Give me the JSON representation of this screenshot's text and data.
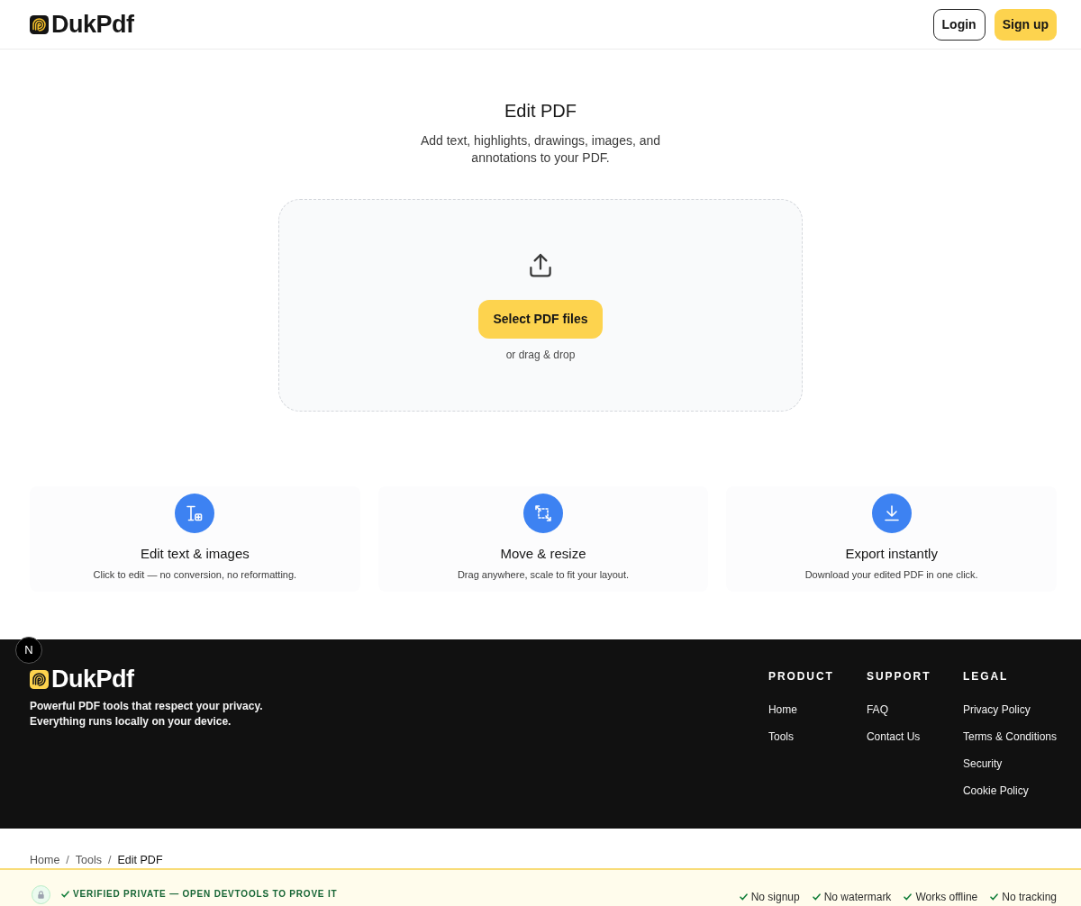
{
  "header": {
    "logo": "DukPdf",
    "buttons": [
      {
        "label": "Login",
        "kind": "outline"
      },
      {
        "label": "Sign up",
        "kind": "primary"
      }
    ]
  },
  "hero": {
    "title": "Edit PDF",
    "subtitle": "Add text, highlights, drawings, images, and annotations to your PDF."
  },
  "dropzone": {
    "button": "Select PDF files",
    "hint": "or drag & drop"
  },
  "features": [
    {
      "kind": "text",
      "title": "Edit text & images",
      "description": "Click to edit — no conversion, no reformatting."
    },
    {
      "kind": "resize",
      "title": "Move & resize",
      "description": "Drag anywhere, scale to fit your layout."
    },
    {
      "kind": "download",
      "title": "Export instantly",
      "description": "Download your edited PDF in one click."
    }
  ],
  "dev_indicator": {
    "label": "N"
  },
  "footer": {
    "logo": "DukPdf",
    "tagline": "Powerful PDF tools that respect your privacy. Everything runs locally on your device.",
    "columns": [
      {
        "heading": "PRODUCT",
        "links": [
          "Home",
          "Tools"
        ]
      },
      {
        "heading": "SUPPORT",
        "links": [
          "FAQ",
          "Contact Us"
        ]
      },
      {
        "heading": "LEGAL",
        "links": [
          "Privacy Policy",
          "Terms & Conditions",
          "Security",
          "Cookie Policy"
        ]
      }
    ]
  },
  "breadcrumb": [
    {
      "label": "Home",
      "current": false
    },
    {
      "separator": "/",
      "label": "Tools",
      "current": false
    },
    {
      "separator": "/",
      "label": "Edit PDF",
      "current": true
    }
  ],
  "trust_bar": {
    "title": "VERIFIED PRIVATE — OPEN DEVTOOLS TO PROVE IT",
    "badges": [
      "No signup",
      "No watermark",
      "Works offline",
      "No tracking"
    ]
  }
}
